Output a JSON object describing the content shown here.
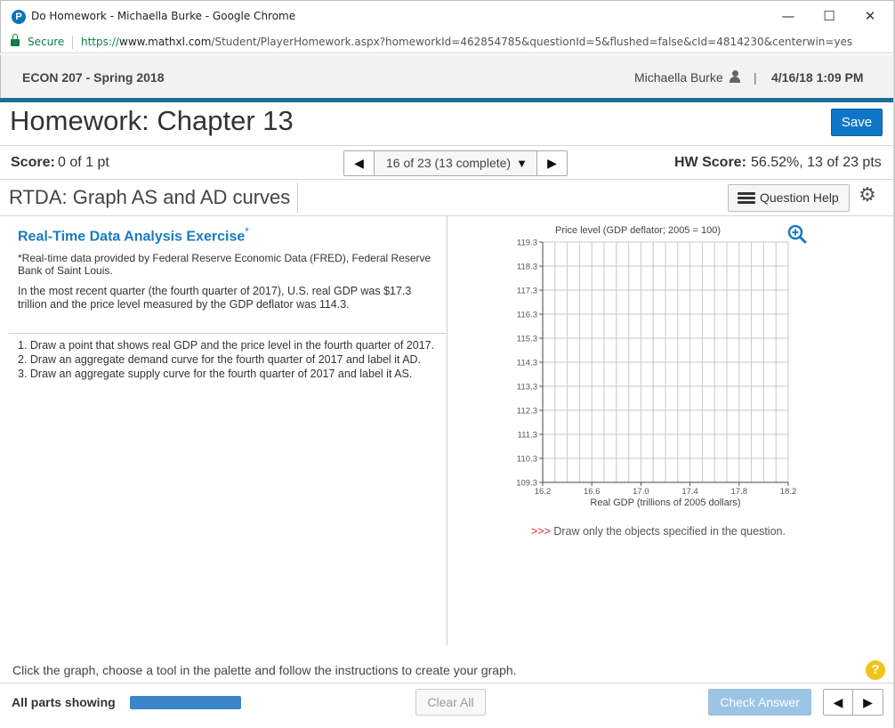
{
  "browser": {
    "window_title": "Do Homework - Michaella Burke - Google Chrome",
    "app_icon_letter": "P",
    "minimize": "—",
    "maximize": "☐",
    "close": "✕",
    "secure_label": "Secure",
    "url_scheme": "https://",
    "url_host": "www.mathxl.com",
    "url_path": "/Student/PlayerHomework.aspx?homeworkId=462854785&questionId=5&flushed=false&cId=4814230&centerwin=yes"
  },
  "header": {
    "course": "ECON 207 - Spring 2018",
    "user": "Michaella Burke",
    "separator": "|",
    "datetime": "4/16/18 1:09 PM"
  },
  "homework": {
    "title": "Homework: Chapter 13",
    "save_label": "Save",
    "score_label": "Score:",
    "score_value": "0 of 1 pt",
    "nav_prev": "◀",
    "nav_next": "▶",
    "question_selector": "16 of 23 (13 complete)",
    "selector_caret": "▼",
    "hw_score_label": "HW Score:",
    "hw_score_value": "56.52%, 13 of 23 pts"
  },
  "question": {
    "title": "RTDA: Graph AS and AD curves",
    "help_label": "Question Help",
    "heading": "Real-Time Data Analysis Exercise",
    "heading_mark": "*",
    "source_note": "*Real-time data provided by Federal Reserve Economic Data (FRED), Federal Reserve Bank of Saint Louis.",
    "intro": "In the most recent quarter (the fourth quarter of 2017), U.S. real GDP was $17.3 trillion and the price level measured by the GDP deflator was 114.3.",
    "instructions": [
      "1. Draw a point that shows real GDP and the price level in the fourth quarter of 2017.",
      "2. Draw an aggregate demand curve for the fourth quarter of 2017 and label it AD.",
      "3. Draw an aggregate supply curve for the fourth quarter of 2017 and label it AS."
    ],
    "draw_note_arrows": ">>>",
    "draw_note": "Draw only the objects specified in the question."
  },
  "chart_data": {
    "type": "scatter",
    "ylabel": "Price level (GDP deflator; 2005 = 100)",
    "xlabel": "Real GDP (trillions of 2005 dollars)",
    "xlim": [
      16.2,
      18.2
    ],
    "ylim": [
      109.3,
      119.3
    ],
    "x_ticks": [
      "16.2",
      "16.6",
      "17.0",
      "17.4",
      "17.8",
      "18.2"
    ],
    "y_ticks": [
      "119.3",
      "118.3",
      "117.3",
      "116.3",
      "115.3",
      "114.3",
      "113.3",
      "112.3",
      "111.3",
      "110.3",
      "109.3"
    ],
    "x_minor_step": 0.1,
    "grid": true,
    "series": []
  },
  "footer": {
    "hint": "Click the graph, choose a tool in the palette and follow the instructions to create your graph.",
    "help_symbol": "?",
    "all_parts": "All parts showing",
    "progress": 1.0,
    "clear_all": "Clear All",
    "check_answer": "Check Answer",
    "prev": "◀",
    "next": "▶"
  },
  "colors": {
    "accent_blue": "#0e76c7",
    "header_rule": "#1d6d9a",
    "heading_blue": "#1a7bc1",
    "warning_red": "#d12b2b"
  }
}
